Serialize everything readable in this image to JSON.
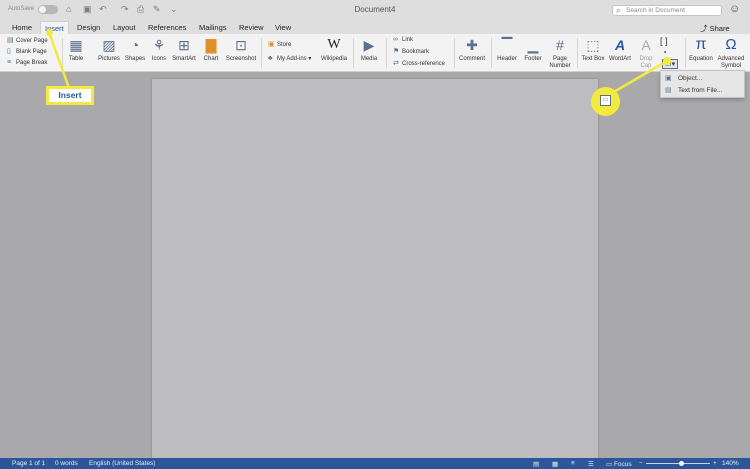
{
  "titlebar": {
    "autosave_label": "AutoSave",
    "autosave_state": "off",
    "document_title": "Document4",
    "search_placeholder": "Search in Document"
  },
  "tabs": {
    "items": [
      "Home",
      "Insert",
      "Design",
      "Layout",
      "References",
      "Mailings",
      "Review",
      "View"
    ],
    "active": "Insert",
    "share_label": "Share"
  },
  "ribbon": {
    "pages": {
      "cover_page": "Cover Page",
      "blank_page": "Blank Page",
      "page_break": "Page Break"
    },
    "table": "Table",
    "pictures": "Pictures",
    "shapes": "Shapes",
    "icons": "Icons",
    "smartart": "SmartArt",
    "chart": "Chart",
    "screenshot": "Screenshot",
    "store": "Store",
    "my_addins": "My Add-ins",
    "wikipedia": "Wikipedia",
    "media": "Media",
    "link": "Link",
    "bookmark": "Bookmark",
    "cross_reference": "Cross-reference",
    "comment": "Comment",
    "header": "Header",
    "footer": "Footer",
    "page_number": "Page Number",
    "text_box": "Text Box",
    "wordart": "WordArt",
    "drop_cap": "Drop Cap",
    "equation": "Equation",
    "advanced_symbol": "Advanced Symbol"
  },
  "object_menu": {
    "object": "Object...",
    "text_from_file": "Text from File..."
  },
  "annotation": {
    "label": "Insert",
    "color": "#f2ea3f"
  },
  "statusbar": {
    "page": "Page 1 of 1",
    "words": "0 words",
    "language": "English (United States)",
    "focus": "Focus",
    "zoom": "140%",
    "zoom_level_fraction": 0.55
  },
  "colors": {
    "accent": "#2b579a",
    "page": "#bdbcbe",
    "background": "#a9a9ab"
  }
}
